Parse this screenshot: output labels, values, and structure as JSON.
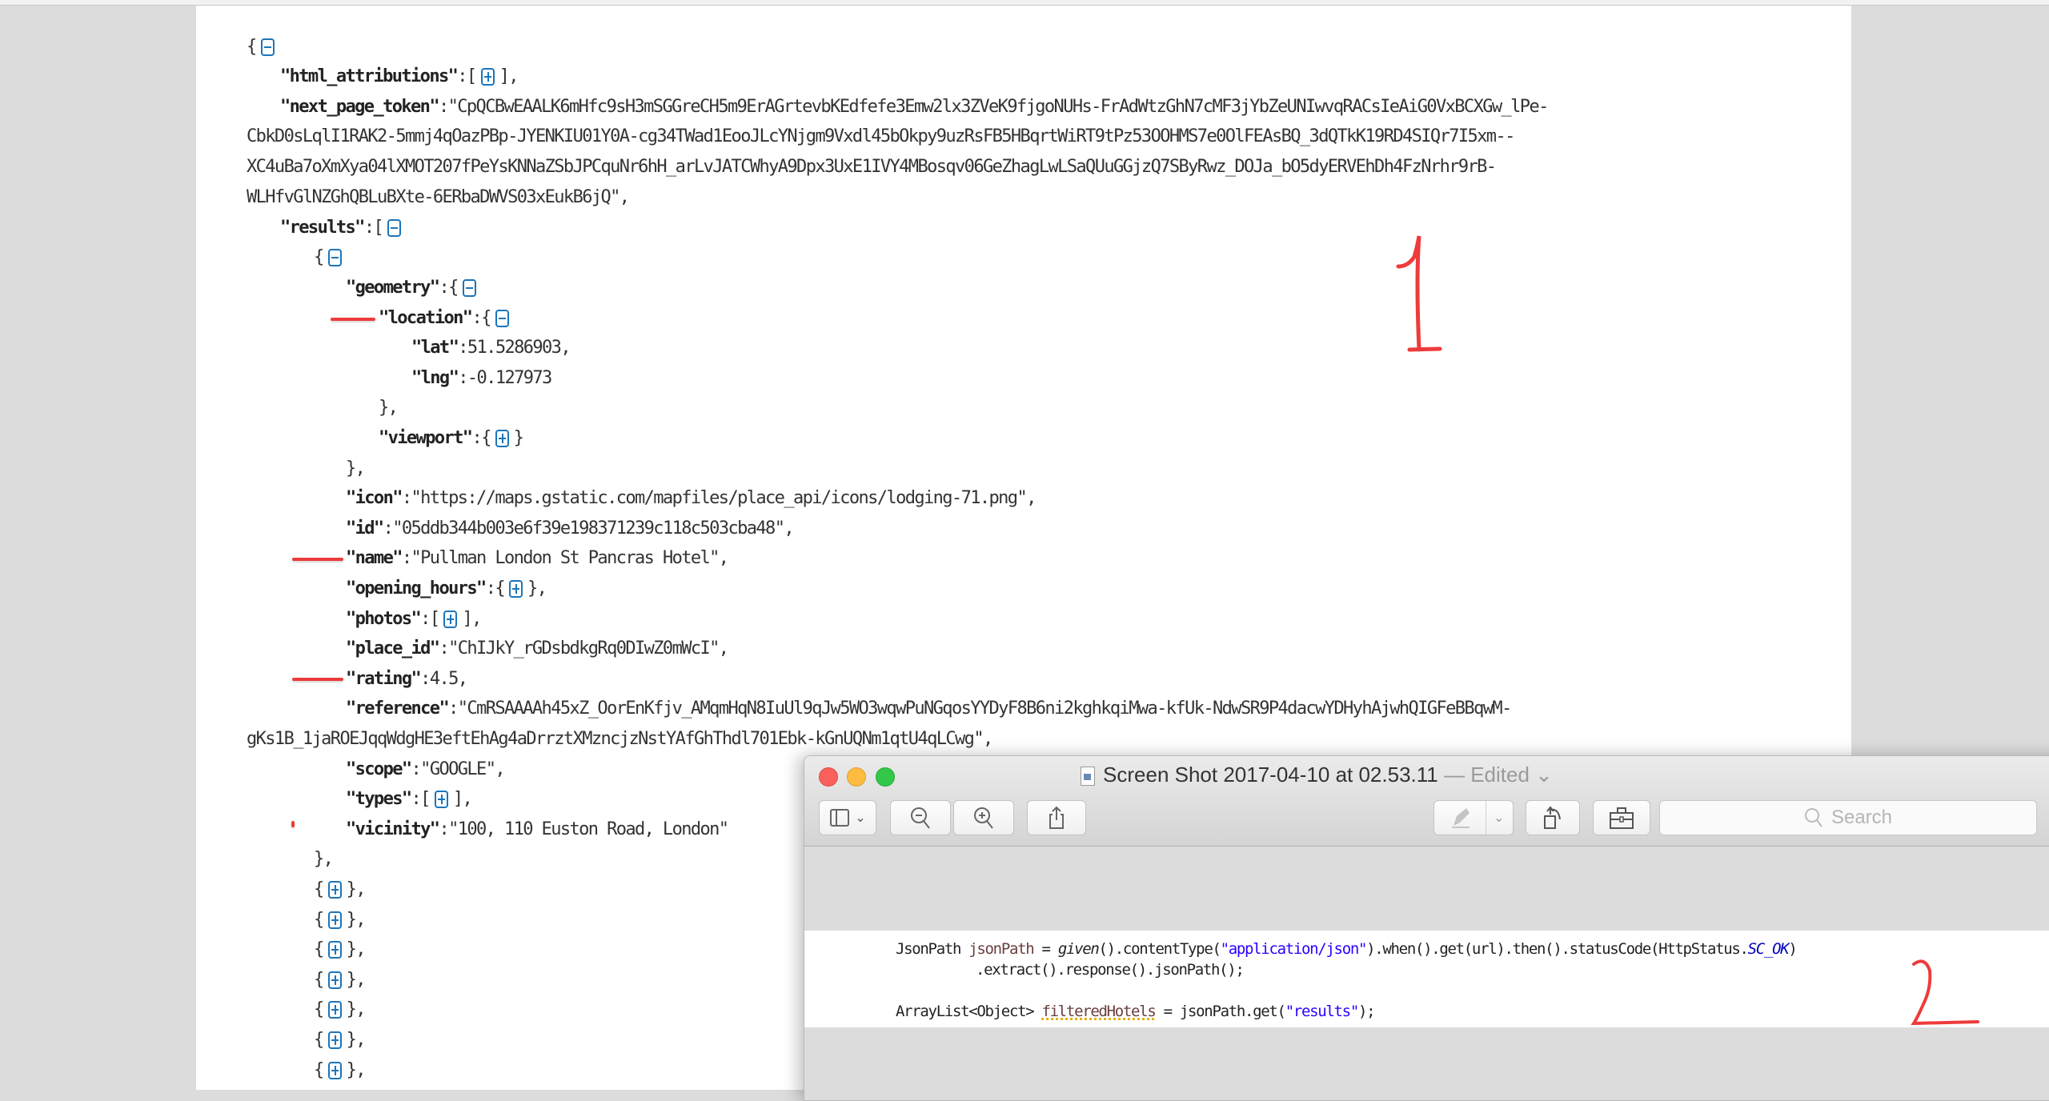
{
  "json_viewer": {
    "lines": {
      "root_open": "{",
      "html_attributions_key": "\"html_attributions\"",
      "html_attributions_rest": ":[",
      "html_attributions_close": "],",
      "next_page_token_key": "\"next_page_token\"",
      "next_page_token_line1": ":\"CpQCBwEAALK6mHfc9sH3mSGGreCH5m9ErAGrtevbKEdfefe3Emw2lx3ZVeK9fjgoNUHs-FrAdWtzGhN7cMF3jYbZeUNIwvqRACsIeAiG0VxBCXGw_lPe-",
      "next_page_token_line2": "CbkD0sLqlI1RAK2-5mmj4qOazPBp-JYENKIU01Y0A-cg34TWad1EooJLcYNjgm9Vxdl45bOkpy9uzRsFB5HBqrtWiRT9tPz53OOHMS7e0OlFEAsBQ_3dQTkK19RD4SIQr7I5xm--",
      "next_page_token_line3": "XC4uBa7oXmXya04lXMOT207fPeYsKNNaZSbJPCquNr6hH_arLvJATCWhyA9Dpx3UxE1IVY4MBosqv06GeZhagLwLSaQUuGGjzQ7SByRwz_DOJa_bO5dyERVEhDh4FzNrhr9rB-",
      "next_page_token_line4": "WLHfvGlNZGhQBLuBXte-6ERbaDWVS03xEukB6jQ\",",
      "results_key": "\"results\"",
      "results_rest": ":[",
      "item_open": "{",
      "geometry_key": "\"geometry\"",
      "geometry_rest": ":{",
      "location_key": "\"location\"",
      "location_rest": ":{",
      "lat_key": "\"lat\"",
      "lat_value": ":51.5286903,",
      "lng_key": "\"lng\"",
      "lng_value": ":-0.127973",
      "location_close": "},",
      "viewport_key": "\"viewport\"",
      "viewport_rest": ":{",
      "viewport_close": "}",
      "geometry_close": "},",
      "icon_key": "\"icon\"",
      "icon_value": ":\"https://maps.gstatic.com/mapfiles/place_api/icons/lodging-71.png\",",
      "id_key": "\"id\"",
      "id_value": ":\"05ddb344b003e6f39e198371239c118c503cba48\",",
      "name_key": "\"name\"",
      "name_value": ":\"Pullman London St Pancras Hotel\",",
      "opening_hours_key": "\"opening_hours\"",
      "opening_hours_rest": ":{",
      "opening_hours_close": "},",
      "photos_key": "\"photos\"",
      "photos_rest": ":[",
      "photos_close": "],",
      "place_id_key": "\"place_id\"",
      "place_id_value": ":\"ChIJkY_rGDsbdkgRq0DIwZ0mWcI\",",
      "rating_key": "\"rating\"",
      "rating_value": ":4.5,",
      "reference_key": "\"reference\"",
      "reference_line1": ":\"CmRSAAAAh45xZ_OorEnKfjv_AMqmHqN8IuUl9qJw5WO3wqwPuNGqosYYDyF8B6ni2kghkqiMwa-kfUk-NdwSR9P4dacwYDHyhAjwhQIGFeBBqwM-",
      "reference_line2": "gKs1B_1jaROEJqqWdgHE3eftEhAg4aDrrztXMzncjzNstYAfGhThdl701Ebk-kGnUQNm1qtU4qLCwg\",",
      "scope_key": "\"scope\"",
      "scope_value": ":\"GOOGLE\",",
      "types_key": "\"types\"",
      "types_rest": ":[",
      "types_close": "],",
      "vicinity_key": "\"vicinity\"",
      "vicinity_value": ":\"100, 110 Euston Road, London\"",
      "item_close": "},",
      "collapsed_open": "{",
      "collapsed_close": "},"
    },
    "collapsed_items_count": 7,
    "annotations": {
      "number_one": "1",
      "number_two": "2",
      "highlight_color": "#ee3b3b"
    }
  },
  "preview_window": {
    "title": "Screen Shot 2017-04-10 at 02.53.11",
    "title_separator": " — ",
    "edited_label": "Edited",
    "search_placeholder": "Search",
    "toolbar": {
      "sidebar_chevron": "⌄",
      "markup_chevron": "⌄"
    },
    "code": {
      "line1_type": "JsonPath ",
      "line1_var": "jsonPath",
      "line1_eq": " = ",
      "line1_given": "given",
      "line1_a": "().contentType(",
      "line1_str": "\"application/json\"",
      "line1_b": ").when().get(url).then().statusCode(HttpStatus.",
      "line1_field": "SC_OK",
      "line1_c": ")",
      "line2": ".extract().response().jsonPath();",
      "line3_type": "ArrayList<Object> ",
      "line3_var": "filteredHotels",
      "line3_a": " = jsonPath.get(",
      "line3_str": "\"results\"",
      "line3_b": ");"
    }
  }
}
